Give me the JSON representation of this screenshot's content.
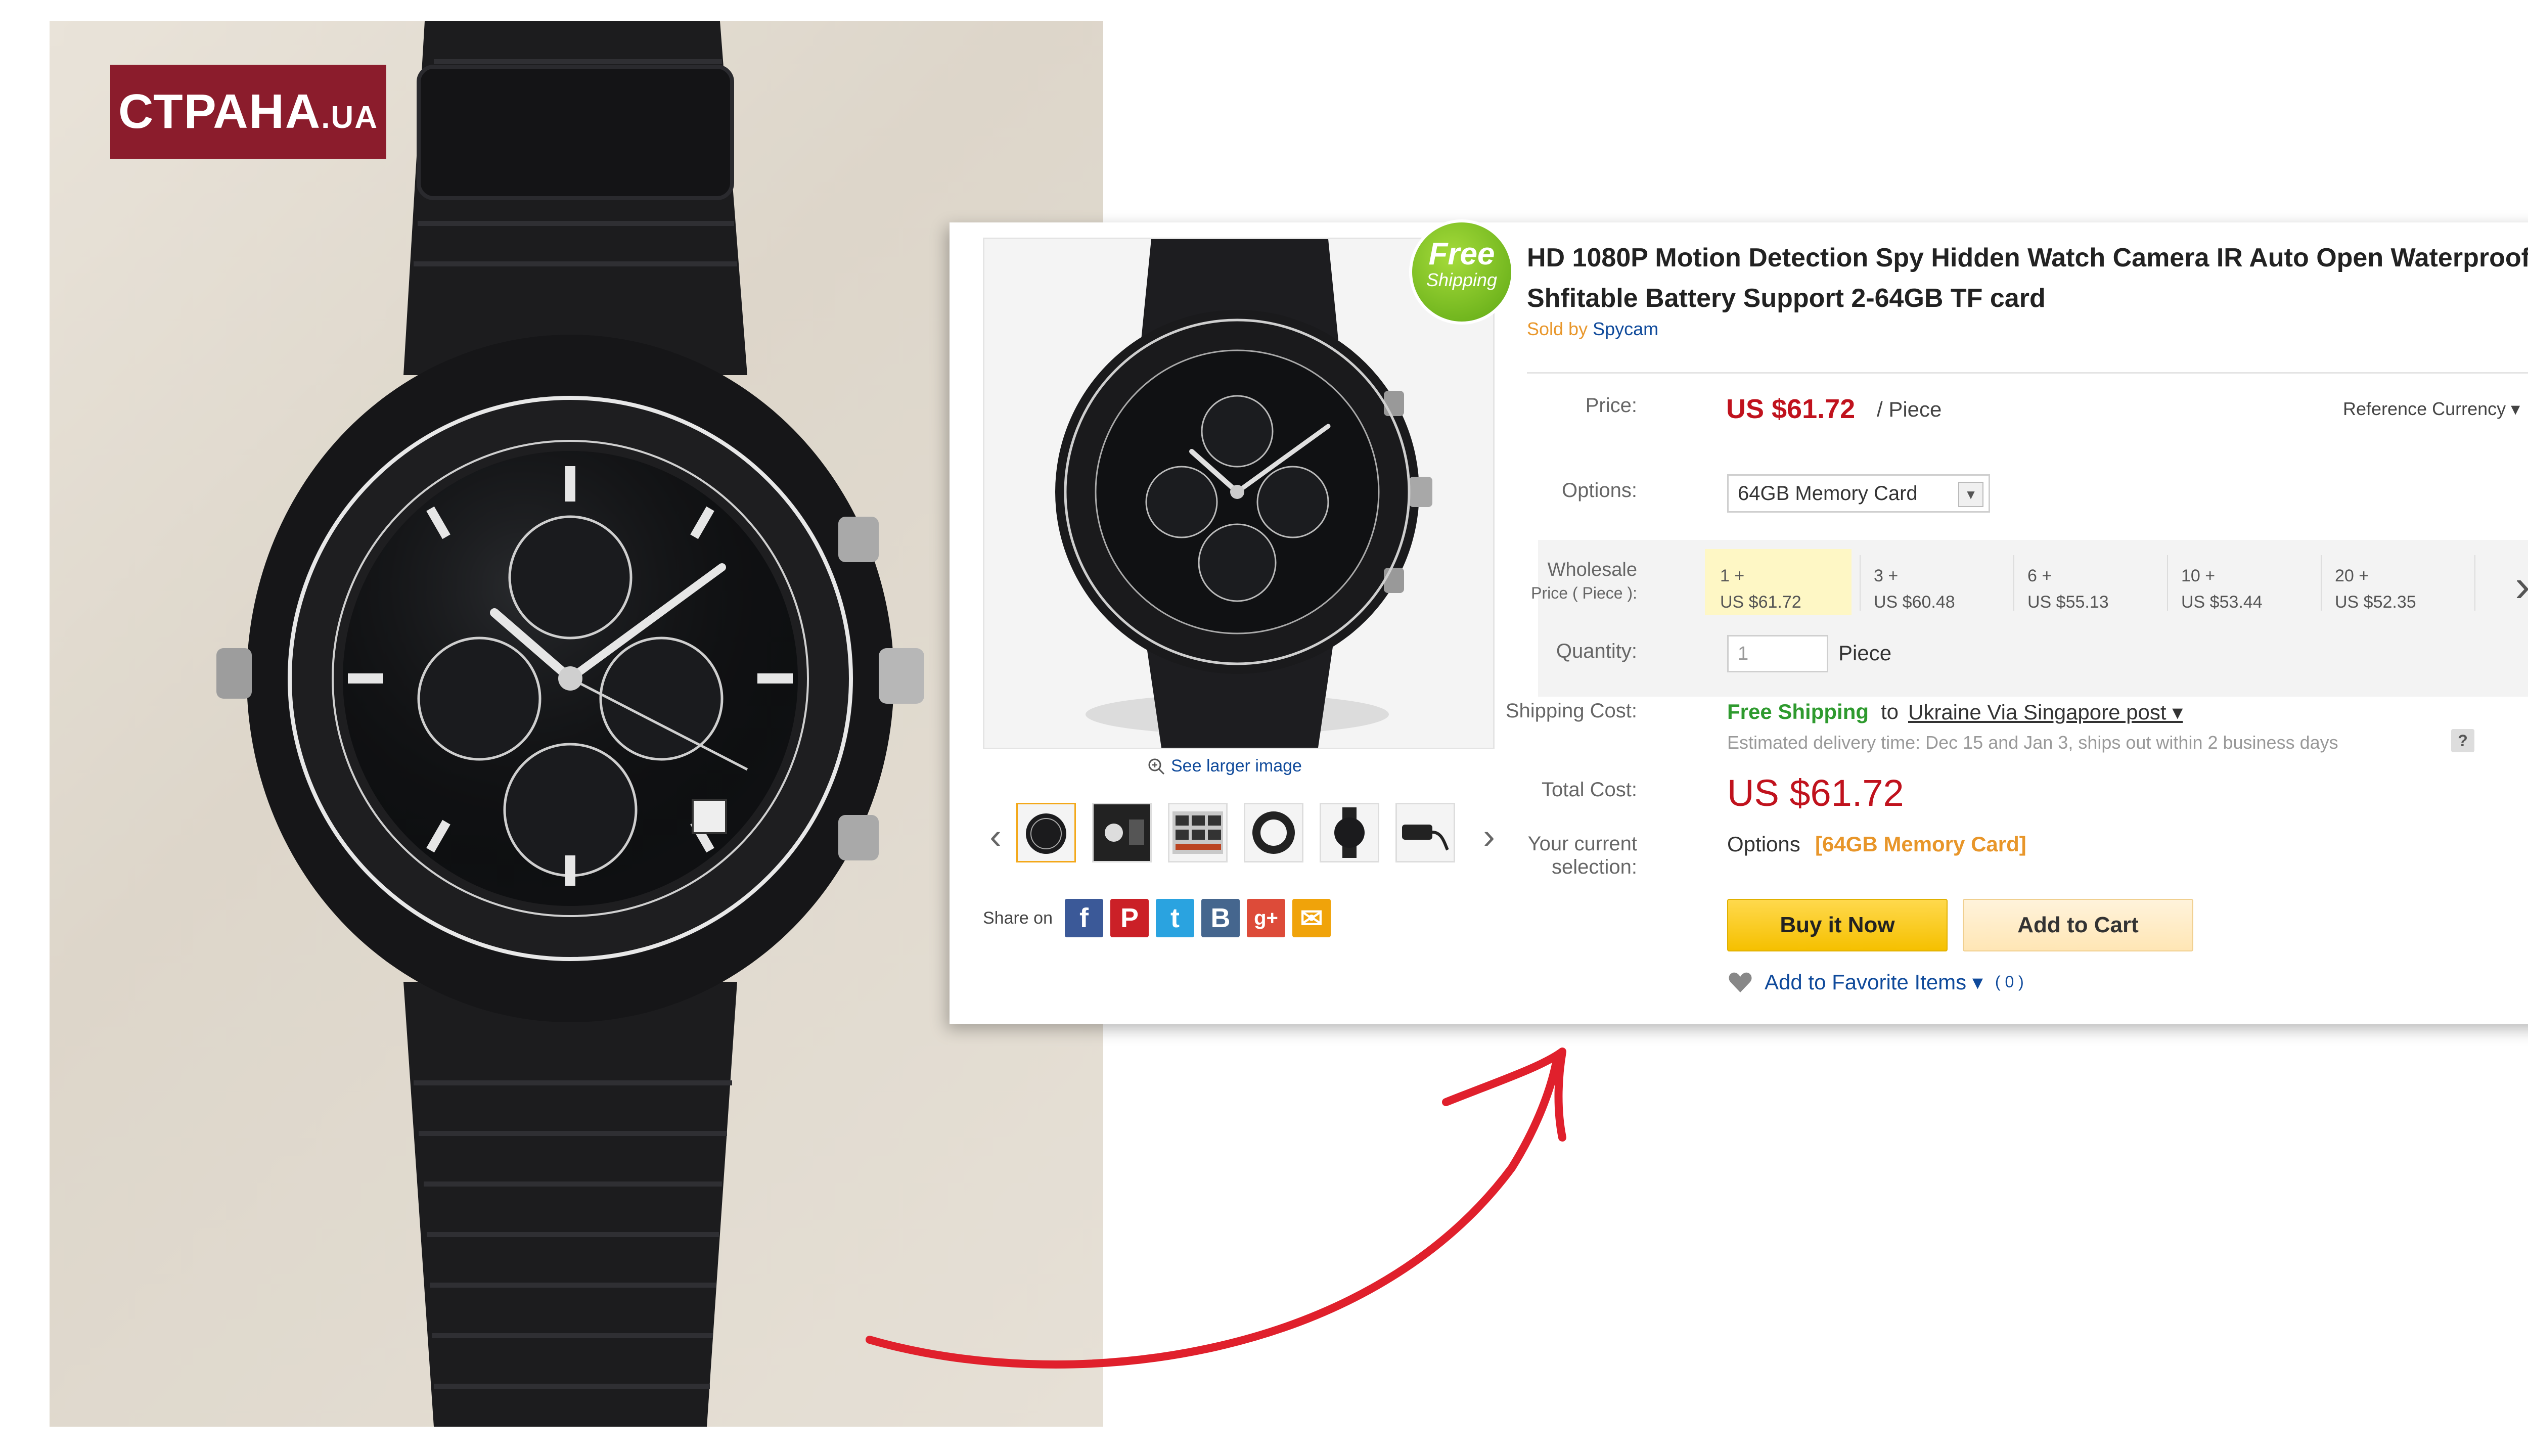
{
  "logo": {
    "main": "СТРАНА",
    "suffix": ".UA"
  },
  "badge": {
    "line1": "Free",
    "line2": "Shipping"
  },
  "product": {
    "title": "HD 1080P Motion Detection Spy Hidden Watch Camera IR Auto Open Waterproof Shfitable Battery Support 2-64GB TF card",
    "sold_by_label": "Sold by",
    "seller": "Spycam",
    "see_larger": "See larger image",
    "share_label": "Share on",
    "social": [
      "f",
      "P",
      "t",
      "B",
      "g+",
      "✉"
    ]
  },
  "price": {
    "label": "Price:",
    "value": "US $61.72",
    "unit": "/ Piece",
    "reference_currency": "Reference Currency ▾"
  },
  "options": {
    "label": "Options:",
    "selected": "64GB Memory Card"
  },
  "wholesale": {
    "label_line1": "Wholesale",
    "label_line2": "Price ( Piece ):",
    "tiers": [
      {
        "qty": "1 +",
        "price": "US $61.72"
      },
      {
        "qty": "3 +",
        "price": "US $60.48"
      },
      {
        "qty": "6 +",
        "price": "US $55.13"
      },
      {
        "qty": "10 +",
        "price": "US $53.44"
      },
      {
        "qty": "20 +",
        "price": "US $52.35"
      }
    ]
  },
  "quantity": {
    "label": "Quantity:",
    "value": "1",
    "unit": "Piece"
  },
  "shipping": {
    "label": "Shipping Cost:",
    "free": "Free Shipping",
    "to": "to",
    "method": "Ukraine Via Singapore post ▾",
    "delivery": "Estimated delivery time: Dec 15 and Jan 3, ships out within 2 business days",
    "help": "?"
  },
  "total": {
    "label": "Total Cost:",
    "value": "US $61.72"
  },
  "selection": {
    "label_line1": "Your current",
    "label_line2": "selection:",
    "options_label": "Options",
    "options_value": "[64GB Memory Card]"
  },
  "buttons": {
    "buy_now": "Buy it Now",
    "add_to_cart": "Add to Cart"
  },
  "favorite": {
    "label": "Add to Favorite Items ▾",
    "count": "( 0 )"
  },
  "colors": {
    "price_red": "#c0121d",
    "link_blue": "#0f4a9b",
    "ship_green": "#2e9a2e",
    "accent_orange": "#e8962a",
    "logo_bg": "#8b1c2c"
  }
}
